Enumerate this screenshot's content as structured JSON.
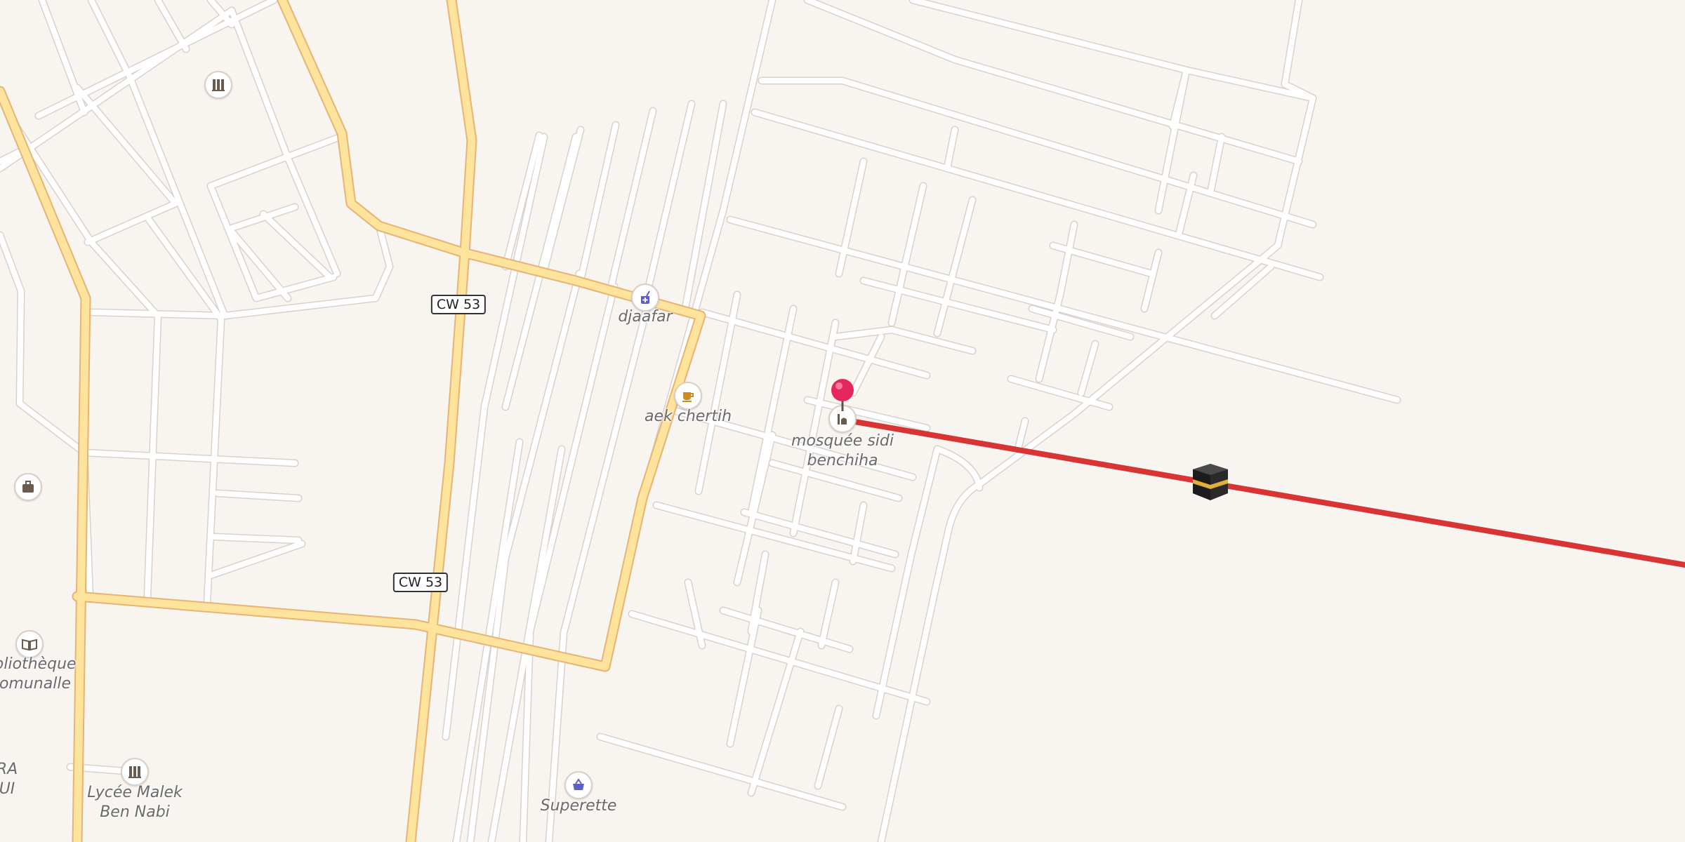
{
  "map": {
    "route_color": "#d93434",
    "road_refs": [
      "CW 53",
      "CW 53"
    ],
    "places": {
      "djaafar": "djaafar",
      "aek_chertih": "aek chertih",
      "mosque": "mosquée sidi\nbenchiha",
      "library": "bliothèque\nomunalle",
      "lycee": "Lycée Malek\nBen Nabi",
      "superette": "Superette",
      "partial_left": "RA\nUI"
    },
    "icons": {
      "school_1": "school-icon",
      "luggage": "luggage-icon",
      "library": "book-icon",
      "school_2": "school-icon",
      "pharmacy": "pharmacy-icon",
      "cafe": "coffee-icon",
      "mosque": "mosque-icon",
      "shop": "basket-icon",
      "kaaba": "kaaba-icon",
      "pin": "location-pin-icon"
    }
  }
}
